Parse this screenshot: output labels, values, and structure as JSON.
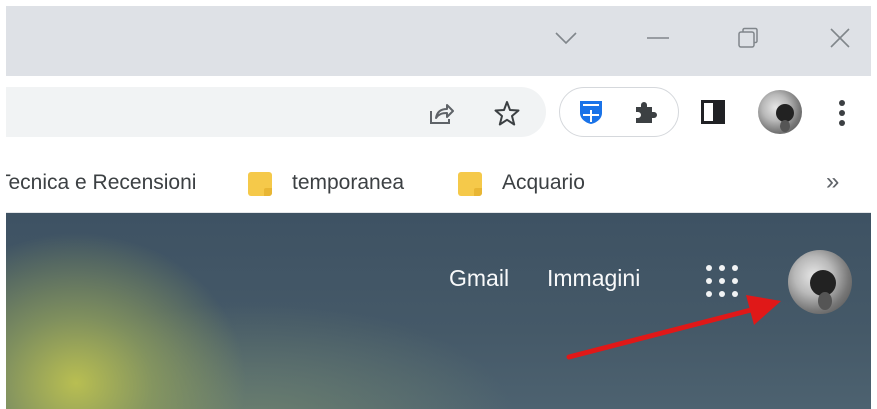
{
  "window_controls": {
    "tab_search_icon": "chevron-down-icon",
    "minimize_icon": "minimize-icon",
    "restore_icon": "restore-icon",
    "close_icon": "close-icon"
  },
  "toolbar": {
    "share_icon": "share-icon",
    "bookmark_star_icon": "star-icon",
    "extensions": [
      "shield-extension-icon",
      "puzzle-extensions-icon"
    ],
    "side_panel_icon": "side-panel-icon",
    "profile_icon": "profile-avatar",
    "menu_icon": "kebab-menu-icon"
  },
  "bookmarks": {
    "items": [
      {
        "label": "Tecnica e Recensioni",
        "icon": "folder-icon"
      },
      {
        "label": "temporanea",
        "icon": "folder-icon"
      },
      {
        "label": "Acquario",
        "icon": "folder-icon"
      }
    ],
    "more_label": "»"
  },
  "page": {
    "gmail_label": "Gmail",
    "images_label": "Immagini",
    "apps_icon": "apps-grid-icon",
    "account_icon": "account-avatar",
    "annotation": {
      "icon": "red-arrow-annotation",
      "color": "#e01818"
    }
  },
  "colors": {
    "titlebar": "#dee1e6",
    "omnibox": "#f1f3f4",
    "folder": "#f5c94a",
    "extension_blue": "#1a73e8",
    "page_dark": "#3e5263",
    "page_green": "#bec350"
  }
}
